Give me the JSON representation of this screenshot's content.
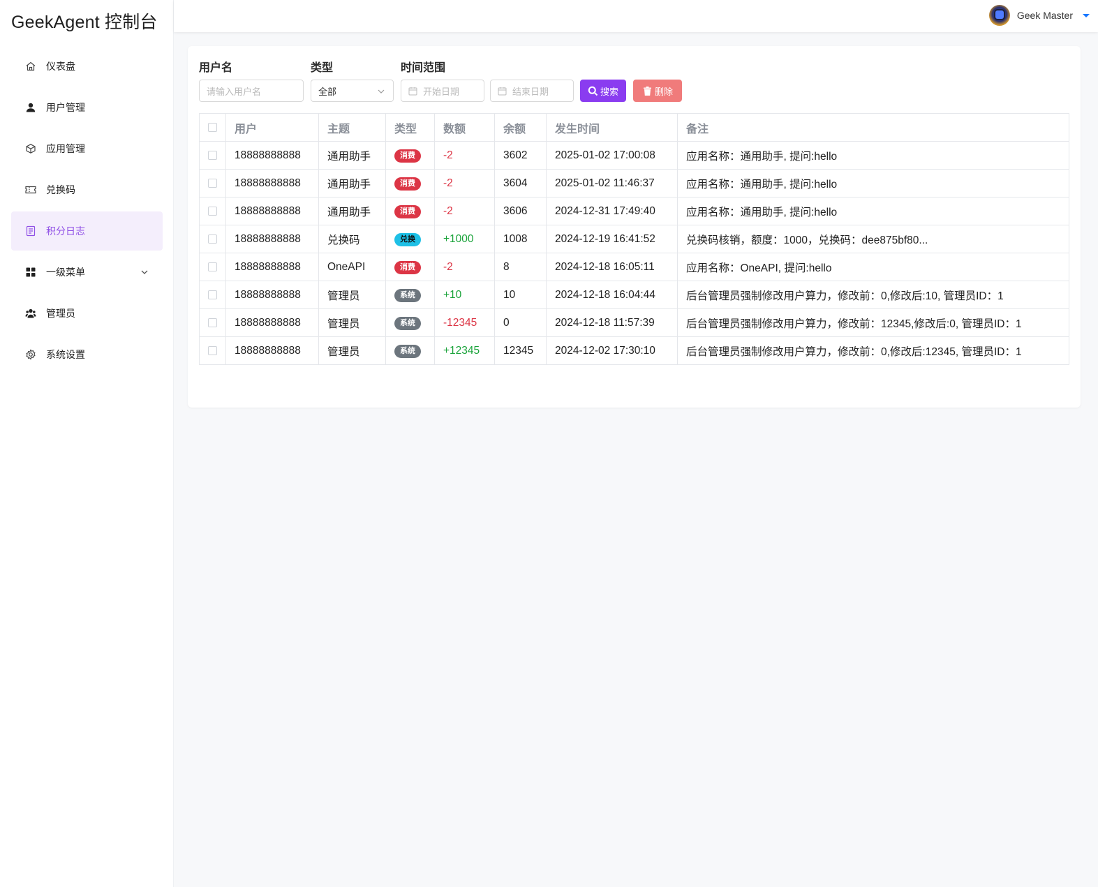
{
  "app": {
    "brand": "GeekAgent 控制台"
  },
  "user": {
    "name": "Geek Master"
  },
  "sidebar": {
    "items": [
      {
        "label": "仪表盘",
        "icon": "home-icon"
      },
      {
        "label": "用户管理",
        "icon": "user-icon"
      },
      {
        "label": "应用管理",
        "icon": "cube-icon"
      },
      {
        "label": "兑换码",
        "icon": "ticket-icon"
      },
      {
        "label": "积分日志",
        "icon": "log-icon",
        "active": true
      },
      {
        "label": "一级菜单",
        "icon": "grid-icon",
        "expandable": true
      },
      {
        "label": "管理员",
        "icon": "team-icon"
      },
      {
        "label": "系统设置",
        "icon": "gear-icon"
      }
    ]
  },
  "filters": {
    "username_label": "用户名",
    "username_placeholder": "请输入用户名",
    "type_label": "类型",
    "type_value": "全部",
    "range_label": "时间范围",
    "start_placeholder": "开始日期",
    "end_placeholder": "结束日期",
    "search_label": "搜索",
    "delete_label": "删除"
  },
  "table": {
    "headers": [
      "用户",
      "主题",
      "类型",
      "数额",
      "余额",
      "发生时间",
      "备注"
    ],
    "rows": [
      {
        "user": "18888888888",
        "subject": "通用助手",
        "type": "消费",
        "kind": "consume",
        "amount": "-2",
        "balance": "3602",
        "time": "2025-01-02 17:00:08",
        "remark": "应用名称：通用助手, 提问:hello"
      },
      {
        "user": "18888888888",
        "subject": "通用助手",
        "type": "消费",
        "kind": "consume",
        "amount": "-2",
        "balance": "3604",
        "time": "2025-01-02 11:46:37",
        "remark": "应用名称：通用助手, 提问:hello"
      },
      {
        "user": "18888888888",
        "subject": "通用助手",
        "type": "消费",
        "kind": "consume",
        "amount": "-2",
        "balance": "3606",
        "time": "2024-12-31 17:49:40",
        "remark": "应用名称：通用助手, 提问:hello"
      },
      {
        "user": "18888888888",
        "subject": "兑换码",
        "type": "兑换",
        "kind": "exchange",
        "amount": "+1000",
        "balance": "1008",
        "time": "2024-12-19 16:41:52",
        "remark": "兑换码核销，额度：1000，兑换码：dee875bf80..."
      },
      {
        "user": "18888888888",
        "subject": "OneAPI",
        "type": "消费",
        "kind": "consume",
        "amount": "-2",
        "balance": "8",
        "time": "2024-12-18 16:05:11",
        "remark": "应用名称：OneAPI, 提问:hello"
      },
      {
        "user": "18888888888",
        "subject": "管理员",
        "type": "系统",
        "kind": "system",
        "amount": "+10",
        "balance": "10",
        "time": "2024-12-18 16:04:44",
        "remark": "后台管理员强制修改用户算力，修改前：0,修改后:10, 管理员ID：1"
      },
      {
        "user": "18888888888",
        "subject": "管理员",
        "type": "系统",
        "kind": "system",
        "amount": "-12345",
        "balance": "0",
        "time": "2024-12-18 11:57:39",
        "remark": "后台管理员强制修改用户算力，修改前：12345,修改后:0, 管理员ID：1"
      },
      {
        "user": "18888888888",
        "subject": "管理员",
        "type": "系统",
        "kind": "system",
        "amount": "+12345",
        "balance": "12345",
        "time": "2024-12-02 17:30:10",
        "remark": "后台管理员强制修改用户算力，修改前：0,修改后:12345, 管理员ID：1"
      }
    ]
  },
  "colors": {
    "accent": "#8a3cf0",
    "active_bg": "#f4eefc",
    "active_text": "#8f4fe6",
    "danger": "#dc3545",
    "success": "#1aa33a",
    "info": "#1ec0e6",
    "secondary": "#6c757d"
  }
}
